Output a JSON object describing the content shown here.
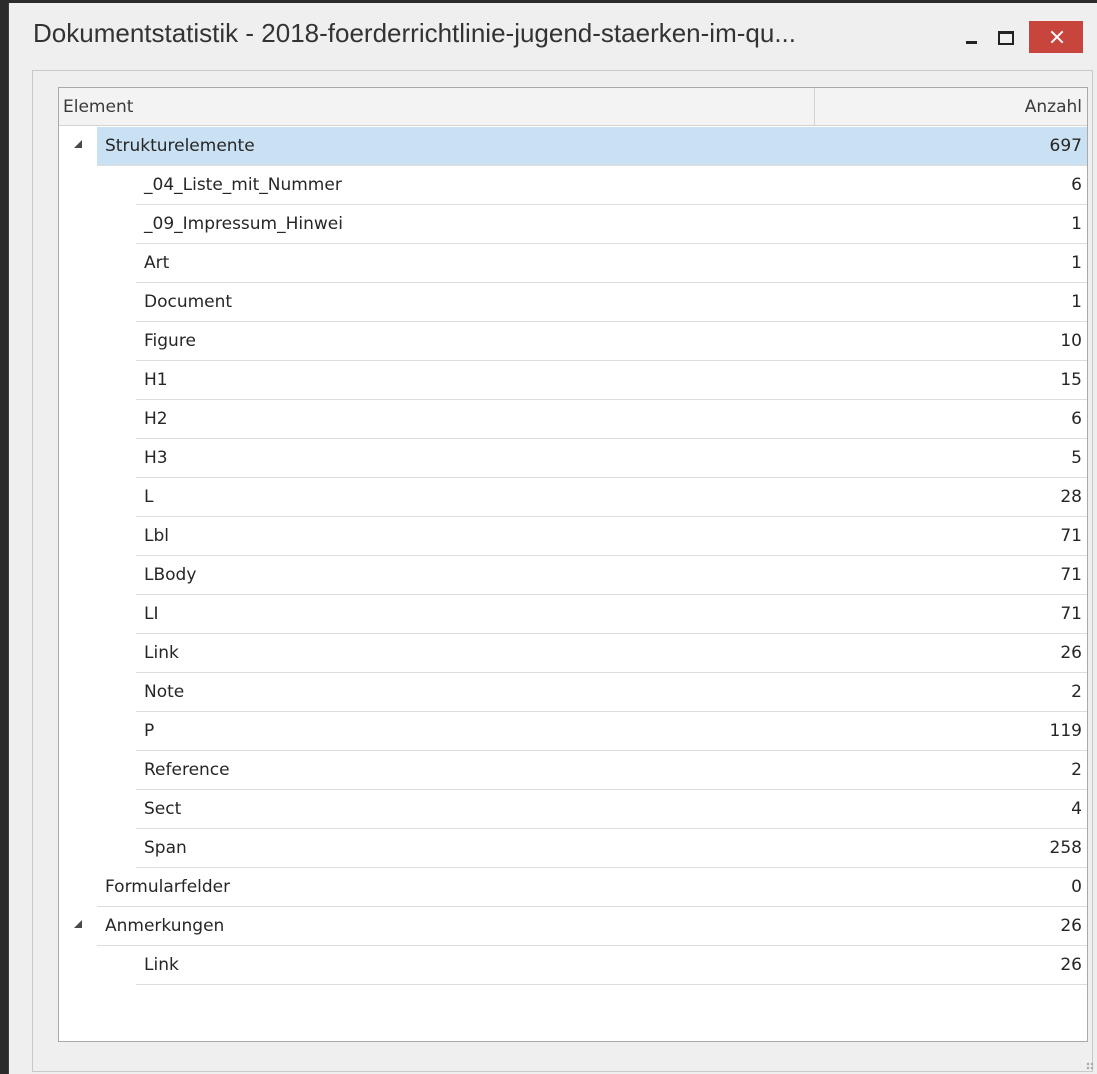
{
  "window": {
    "title": "Dokumentstatistik - 2018-foerderrichtlinie-jugend-staerken-im-qu..."
  },
  "table": {
    "headers": {
      "element": "Element",
      "count": "Anzahl"
    },
    "rows": [
      {
        "label": "Strukturelemente",
        "count": "697",
        "level": 0,
        "expander": true,
        "selected": true
      },
      {
        "label": "_04_Liste_mit_Nummer",
        "count": "6",
        "level": 1
      },
      {
        "label": "_09_Impressum_Hinwei",
        "count": "1",
        "level": 1
      },
      {
        "label": "Art",
        "count": "1",
        "level": 1
      },
      {
        "label": "Document",
        "count": "1",
        "level": 1
      },
      {
        "label": "Figure",
        "count": "10",
        "level": 1
      },
      {
        "label": "H1",
        "count": "15",
        "level": 1
      },
      {
        "label": "H2",
        "count": "6",
        "level": 1
      },
      {
        "label": "H3",
        "count": "5",
        "level": 1
      },
      {
        "label": "L",
        "count": "28",
        "level": 1
      },
      {
        "label": "Lbl",
        "count": "71",
        "level": 1
      },
      {
        "label": "LBody",
        "count": "71",
        "level": 1
      },
      {
        "label": "LI",
        "count": "71",
        "level": 1
      },
      {
        "label": "Link",
        "count": "26",
        "level": 1
      },
      {
        "label": "Note",
        "count": "2",
        "level": 1
      },
      {
        "label": "P",
        "count": "119",
        "level": 1
      },
      {
        "label": "Reference",
        "count": "2",
        "level": 1
      },
      {
        "label": "Sect",
        "count": "4",
        "level": 1
      },
      {
        "label": "Span",
        "count": "258",
        "level": 1
      },
      {
        "label": "Formularfelder",
        "count": "0",
        "level": 0
      },
      {
        "label": "Anmerkungen",
        "count": "26",
        "level": 0,
        "expander": true
      },
      {
        "label": "Link",
        "count": "26",
        "level": 1
      }
    ]
  },
  "colors": {
    "selection": "#c9e1f3",
    "close_button": "#c8453e"
  }
}
